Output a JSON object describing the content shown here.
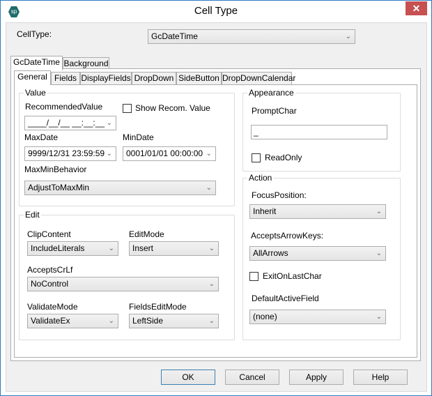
{
  "window": {
    "title": "Cell Type",
    "app_icon_text": "sp",
    "close_glyph": "✕"
  },
  "celltype": {
    "label": "CellType:",
    "value": "GcDateTime"
  },
  "outer_tabs": [
    {
      "label": "GcDateTime",
      "active": true
    },
    {
      "label": "Background",
      "active": false
    }
  ],
  "inner_tabs": [
    {
      "label": "General",
      "active": true
    },
    {
      "label": "Fields",
      "active": false
    },
    {
      "label": "DisplayFields",
      "active": false
    },
    {
      "label": "DropDown",
      "active": false
    },
    {
      "label": "SideButton",
      "active": false
    },
    {
      "label": "DropDownCalendar",
      "active": false
    }
  ],
  "value_group": {
    "title": "Value",
    "recommended_label": "RecommendedValue",
    "recommended_value": "____/__/__ __:__:__",
    "show_recom_label": "Show Recom. Value",
    "show_recom_checked": false,
    "maxdate_label": "MaxDate",
    "maxdate_value": "9999/12/31 23:59:59",
    "mindate_label": "MinDate",
    "mindate_value": "0001/01/01 00:00:00",
    "maxmin_label": "MaxMinBehavior",
    "maxmin_value": "AdjustToMaxMin"
  },
  "edit_group": {
    "title": "Edit",
    "clipcontent_label": "ClipContent",
    "clipcontent_value": "IncludeLiterals",
    "editmode_label": "EditMode",
    "editmode_value": "Insert",
    "acceptscrlf_label": "AcceptsCrLf",
    "acceptscrlf_value": "NoControl",
    "validatemode_label": "ValidateMode",
    "validatemode_value": "ValidateEx",
    "fieldseditmode_label": "FieldsEditMode",
    "fieldseditmode_value": "LeftSide"
  },
  "appearance_group": {
    "title": "Appearance",
    "promptchar_label": "PromptChar",
    "promptchar_value": "_",
    "readonly_label": "ReadOnly",
    "readonly_checked": false
  },
  "action_group": {
    "title": "Action",
    "focusposition_label": "FocusPosition:",
    "focusposition_value": "Inherit",
    "acceptsarrowkeys_label": "AcceptsArrowKeys:",
    "acceptsarrowkeys_value": "AllArrows",
    "exitonlastchar_label": "ExitOnLastChar",
    "exitonlastchar_checked": false,
    "defaultactivefield_label": "DefaultActiveField",
    "defaultactivefield_value": "(none)"
  },
  "buttons": {
    "ok": "OK",
    "cancel": "Cancel",
    "apply": "Apply",
    "help": "Help"
  },
  "icons": {
    "chevron": "⌄"
  }
}
